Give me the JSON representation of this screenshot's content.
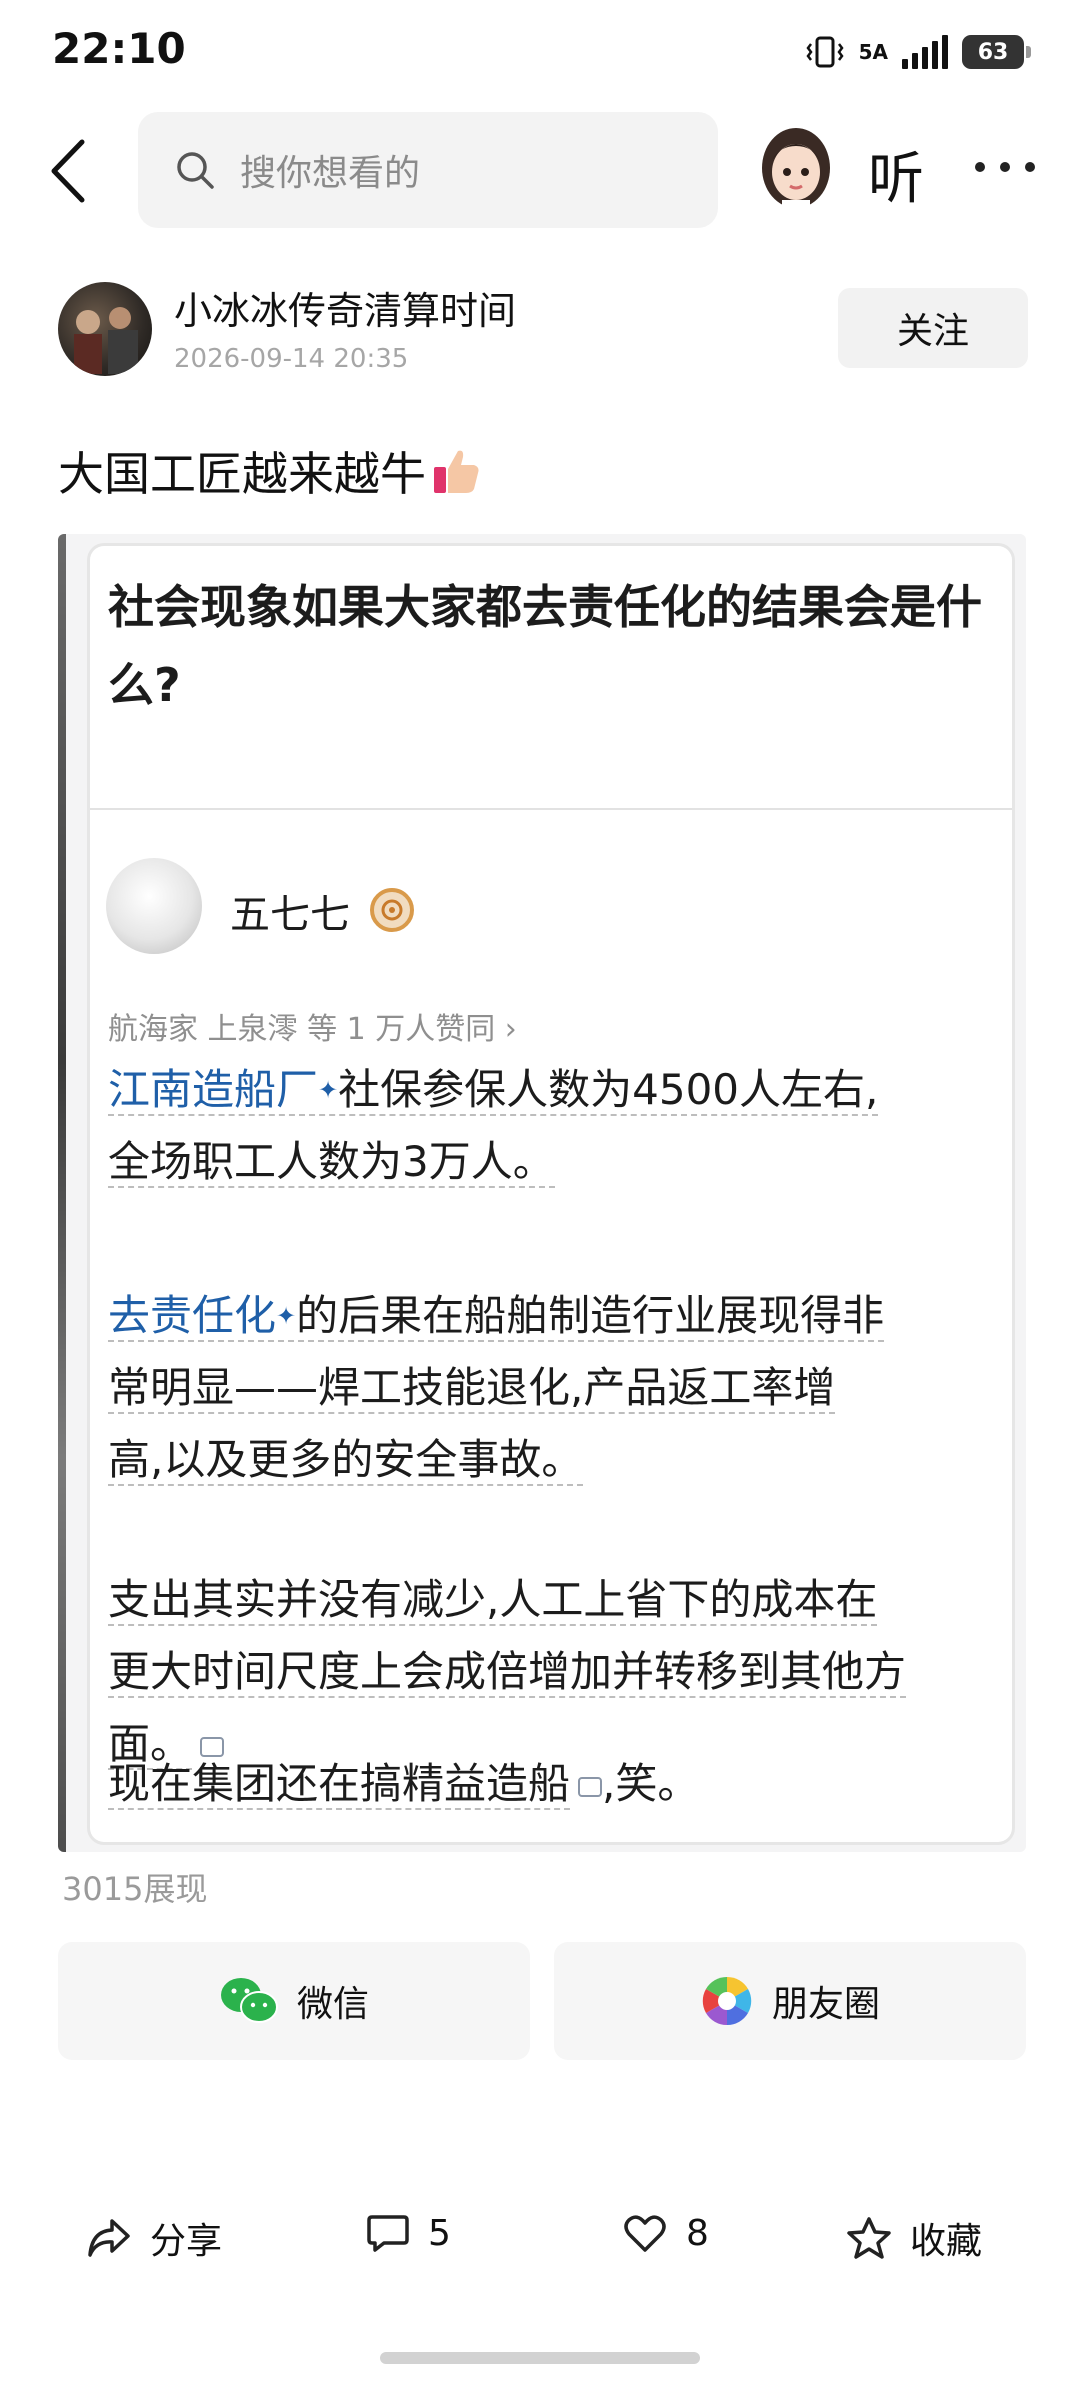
{
  "status_bar": {
    "time": "22:10",
    "network": "5A",
    "battery": "63"
  },
  "top_nav": {
    "search_placeholder": "搜你想看的",
    "listen_label": "听"
  },
  "author": {
    "name": "小冰冰传奇清算时间",
    "time": "2026-09-14 20:35",
    "follow_label": "关注"
  },
  "post": {
    "title": "大国工匠越来越牛"
  },
  "screenshot": {
    "question": "社会现象如果大家都去责任化的结果会是什么?",
    "answerer": "五七七",
    "likes_line": "航海家 上泉澪 等 1 万人赞同 ›",
    "p1_link": "江南造船厂",
    "p1_line1_rest": "社保参保人数为4500人左右,",
    "p1_line2": "全场职工人数为3万人。",
    "p2_link": "去责任化",
    "p2_line1_rest": "的后果在船舶制造行业展现得非",
    "p2_line2": "常明显——焊工技能退化,产品返工率增",
    "p2_line3": "高,以及更多的安全事故。",
    "p3_line1": "支出其实并没有减少,人工上省下的成本在",
    "p3_line2": "更大时间尺度上会成倍增加并转移到其他方",
    "p3_line3": "面。",
    "p4_a": "现在集团还在搞精益造船",
    "p4_b": ",笑。",
    "sup_mark": "✦"
  },
  "views": "3015展现",
  "share": {
    "wechat_label": "微信",
    "moments_label": "朋友圈"
  },
  "bottom_bar": {
    "share_label": "分享",
    "comments_count": "5",
    "likes_count": "8",
    "favorite_label": "收藏"
  }
}
